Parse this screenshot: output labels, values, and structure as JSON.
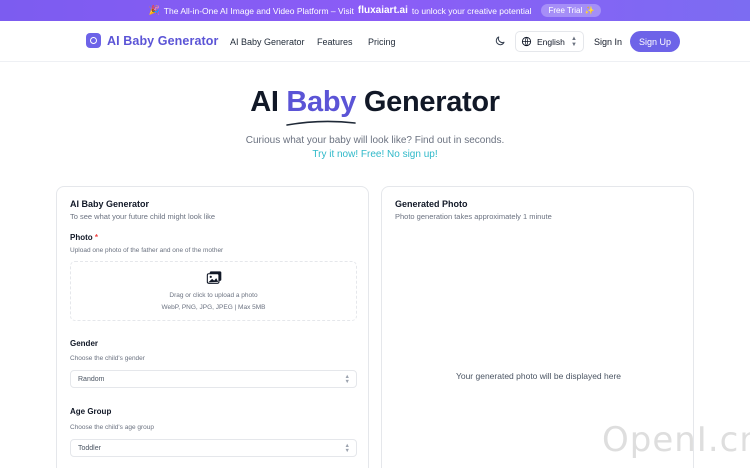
{
  "banner": {
    "emoji": "🎉",
    "text_before": "The All-in-One AI Image and Video Platform – Visit",
    "brand": "fluxaiart.ai",
    "text_after": "to unlock your creative potential",
    "trial": "Free Trial ✨"
  },
  "nav": {
    "logo_text": "AI Baby Generator",
    "links": [
      "AI Baby Generator",
      "Features",
      "Pricing"
    ],
    "theme_icon": "moon-icon",
    "language": "English",
    "sign_in": "Sign In",
    "sign_up": "Sign Up"
  },
  "hero": {
    "title_before": "AI",
    "title_accent": "Baby",
    "title_after": "Generator",
    "subtitle": "Curious what your baby will look like? Find out in seconds.",
    "tagline": "Try it now! Free! No sign up!"
  },
  "form": {
    "title": "AI Baby Generator",
    "subtitle": "To see what your future child might look like",
    "photo_label": "Photo",
    "photo_required": "*",
    "photo_hint": "Upload one photo of the father and one of the mother",
    "upload_text": "Drag or click to upload a photo",
    "upload_formats": "WebP, PNG, JPG, JPEG | Max 5MB",
    "gender_label": "Gender",
    "gender_hint": "Choose the child's gender",
    "gender_value": "Random",
    "age_label": "Age Group",
    "age_hint": "Choose the child's age group",
    "age_value": "Toddler"
  },
  "result": {
    "title": "Generated Photo",
    "subtitle": "Photo generation takes approximately 1 minute",
    "placeholder": "Your generated photo will be displayed here"
  },
  "watermark": "OpenI.cn",
  "colors": {
    "accent": "#6d63e8",
    "tagline": "#2fb9c9",
    "banner": "#8b5cf6"
  }
}
